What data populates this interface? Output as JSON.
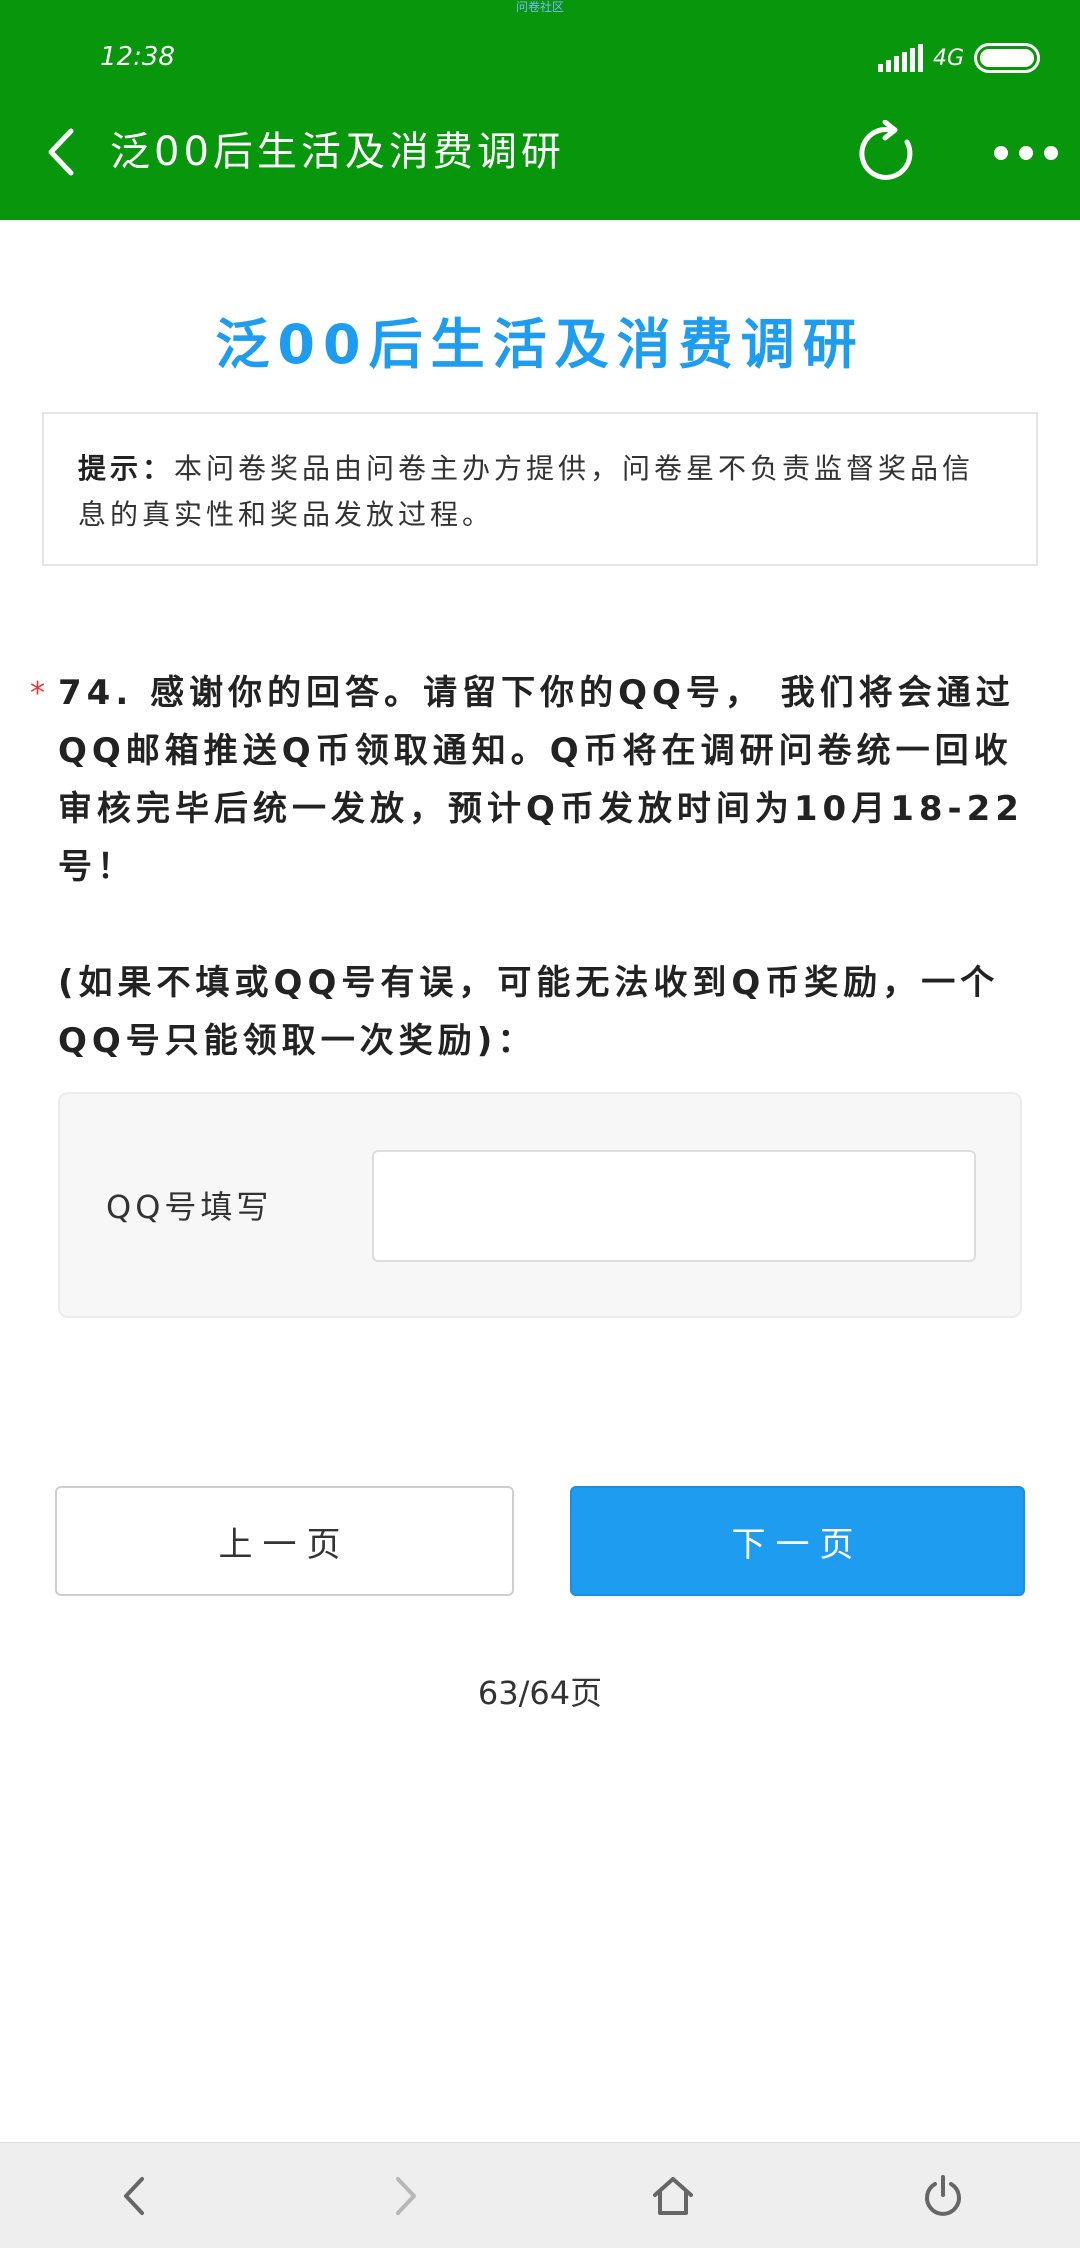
{
  "status_bar": {
    "watermark": "问卷社区",
    "time": "12:38",
    "network": "4G"
  },
  "header": {
    "title": "泛00后生活及消费调研",
    "icons": [
      "back-arrow-icon",
      "refresh-icon",
      "more-icon"
    ]
  },
  "survey": {
    "title": "泛00后生活及消费调研",
    "notice_label": "提示：",
    "notice_text": "本问卷奖品由问卷主办方提供，问卷星不负责监督奖品信息的真实性和奖品发放过程。"
  },
  "question": {
    "required_mark": "*",
    "text": "74. 感谢你的回答。请留下你的QQ号， 我们将会通过QQ邮箱推送Q币领取通知。Q币将在调研问卷统一回收审核完毕后统一发放，预计Q币发放时间为10月18-22号！",
    "note": "(如果不填或QQ号有误，可能无法收到Q币奖励，一个QQ号只能领取一次奖励)：",
    "field_label": "QQ号填写",
    "field_value": ""
  },
  "navigation": {
    "prev_label": "上一页",
    "next_label": "下一页",
    "page_indicator": "63/64页"
  },
  "bottom_bar": {
    "icons": [
      "back-icon",
      "forward-icon",
      "home-icon",
      "power-icon"
    ]
  },
  "colors": {
    "header_bg": "#08960c",
    "accent": "#1e9cf0",
    "required": "#e53935"
  }
}
